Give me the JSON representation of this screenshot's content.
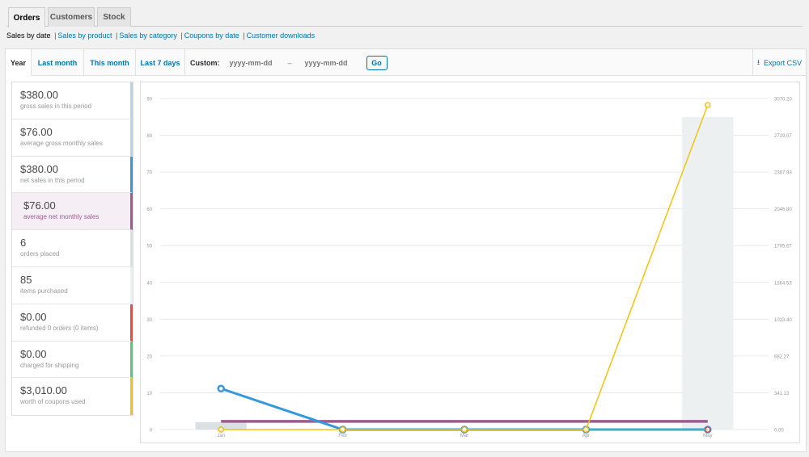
{
  "tabs": [
    {
      "label": "Orders",
      "active": true
    },
    {
      "label": "Customers",
      "active": false
    },
    {
      "label": "Stock",
      "active": false
    }
  ],
  "subnav": {
    "current": "Sales by date",
    "links": [
      "Sales by product",
      "Sales by category",
      "Coupons by date",
      "Customer downloads"
    ]
  },
  "ranges": [
    {
      "label": "Year",
      "active": true
    },
    {
      "label": "Last month",
      "active": false
    },
    {
      "label": "This month",
      "active": false
    },
    {
      "label": "Last 7 days",
      "active": false
    }
  ],
  "custom": {
    "label": "Custom:",
    "from_placeholder": "yyyy-mm-dd",
    "separator": "–",
    "to_placeholder": "yyyy-mm-dd",
    "go_label": "Go"
  },
  "export": {
    "label": "Export CSV",
    "icon": "download-icon"
  },
  "legend": [
    {
      "value": "$380.00",
      "desc": "gross sales in this period",
      "color": "#b1d4ea"
    },
    {
      "value": "$76.00",
      "desc": "average gross monthly sales",
      "color": "#b1d4ea"
    },
    {
      "value": "$380.00",
      "desc": "net sales in this period",
      "color": "#3498db"
    },
    {
      "value": "$76.00",
      "desc": "average net monthly sales",
      "color": "#9b5c8f",
      "highlight": true
    },
    {
      "value": "6",
      "desc": "orders placed",
      "color": "#dbe1e3"
    },
    {
      "value": "85",
      "desc": "items purchased",
      "color": "#ecf0f1"
    },
    {
      "value": "$0.00",
      "desc": "refunded 0 orders (0 items)",
      "color": "#e74c3c"
    },
    {
      "value": "$0.00",
      "desc": "charged for shipping",
      "color": "#5cc488"
    },
    {
      "value": "$3,010.00",
      "desc": "worth of coupons used",
      "color": "#f1c40f"
    }
  ],
  "chart_data": {
    "type": "line",
    "categories": [
      "Jan",
      "Feb",
      "Mar",
      "Apr",
      "May"
    ],
    "y_left_ticks": [
      "0",
      "10",
      "20",
      "30",
      "40",
      "50",
      "60",
      "70",
      "80",
      "90"
    ],
    "y_left_range": [
      0,
      90
    ],
    "y_right_ticks": [
      "0.00",
      "341.13",
      "682.27",
      "1023.40",
      "1364.53",
      "1705.67",
      "2046.80",
      "2387.93",
      "2729.07",
      "3070.20"
    ],
    "y_right_range": [
      0,
      3070.2
    ],
    "bars": [
      {
        "name": "orders placed",
        "color": "#dbe1e3",
        "axis": "left",
        "values": [
          2,
          0,
          0,
          0,
          4
        ]
      },
      {
        "name": "items purchased",
        "color": "#ecf0f1",
        "axis": "left",
        "values": [
          0,
          0,
          0,
          0,
          85
        ]
      }
    ],
    "series": [
      {
        "name": "average net monthly sales",
        "color": "#9b5c8f",
        "axis": "right",
        "width": 3.5,
        "markers": false,
        "values": [
          76,
          76,
          76,
          76,
          76
        ]
      },
      {
        "name": "net sales in this period",
        "color": "#3498db",
        "axis": "right",
        "width": 3,
        "markers": true,
        "values": [
          380,
          0,
          0,
          0,
          0
        ]
      },
      {
        "name": "refunded 0 orders (0 items)",
        "color": "#e74c3c",
        "axis": "right",
        "width": 1,
        "markers": true,
        "values": [
          0,
          0,
          0,
          0,
          0
        ]
      },
      {
        "name": "charged for shipping",
        "color": "#5cc488",
        "axis": "right",
        "width": 1,
        "markers": false,
        "values": [
          0,
          0,
          0,
          0,
          0
        ]
      },
      {
        "name": "worth of coupons used",
        "color": "#f1c40f",
        "axis": "right",
        "width": 1.5,
        "markers": true,
        "values": [
          0,
          0,
          0,
          0,
          3010
        ]
      }
    ]
  }
}
